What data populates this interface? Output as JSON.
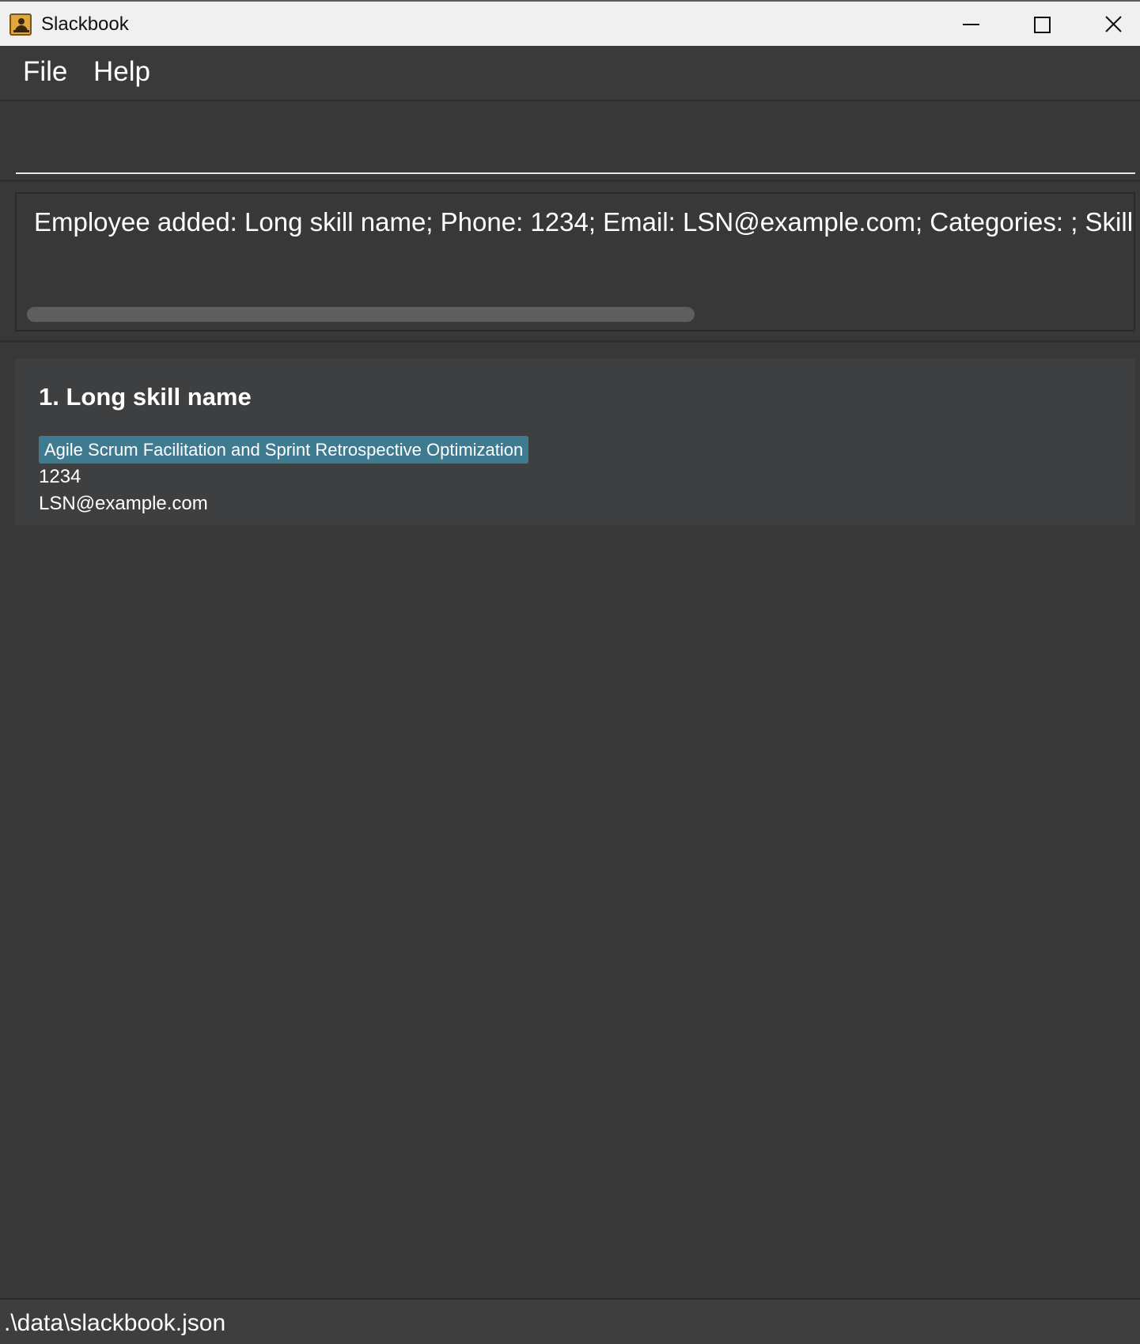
{
  "window": {
    "title": "Slackbook",
    "icon": "address-book-icon"
  },
  "menu": {
    "items": [
      {
        "label": "File"
      },
      {
        "label": "Help"
      }
    ]
  },
  "command": {
    "value": "",
    "placeholder": ""
  },
  "result": {
    "message": "Employee added: Long skill name; Phone: 1234; Email: LSN@example.com; Categories: ; Skills: Agile Scrum Facilitation and Sprint Retrospective Optimization"
  },
  "persons": [
    {
      "index_name": "1. Long skill name",
      "skills": [
        "Agile Scrum Facilitation and Sprint Retrospective Optimization"
      ],
      "phone": "1234",
      "email": "LSN@example.com"
    }
  ],
  "status": {
    "path": ".\\data\\slackbook.json"
  },
  "colors": {
    "background": "#383838",
    "card": "#3d3f41",
    "skill_tag": "#3e7b91",
    "titlebar": "#f0f0f0"
  }
}
